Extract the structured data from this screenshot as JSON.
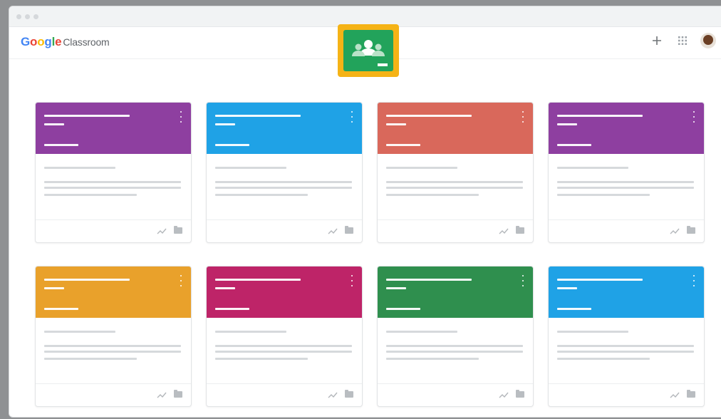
{
  "window": {
    "title_dots": [
      "close",
      "minimize",
      "maximize"
    ]
  },
  "header": {
    "logo_letters": [
      {
        "ch": "G",
        "color": "#4285F4"
      },
      {
        "ch": "o",
        "color": "#EA4335"
      },
      {
        "ch": "o",
        "color": "#FBBC05"
      },
      {
        "ch": "g",
        "color": "#4285F4"
      },
      {
        "ch": "l",
        "color": "#34A853"
      },
      {
        "ch": "e",
        "color": "#EA4335"
      }
    ],
    "product_name": "Classroom",
    "add_icon": "plus-icon",
    "apps_icon": "apps-grid-icon",
    "avatar_icon": "account-avatar"
  },
  "app_badge": {
    "icon": "classroom-app-icon",
    "outer_color": "#F5B316",
    "inner_color": "#22A35B"
  },
  "classes": [
    {
      "color": "#8E3FA0"
    },
    {
      "color": "#1FA2E6"
    },
    {
      "color": "#D9685B"
    },
    {
      "color": "#8E3FA0"
    },
    {
      "color": "#E9A12B"
    },
    {
      "color": "#BE2468"
    },
    {
      "color": "#2F8F4E"
    },
    {
      "color": "#1FA2E6"
    }
  ],
  "card_footer_icons": [
    "trending-icon",
    "folder-icon"
  ]
}
